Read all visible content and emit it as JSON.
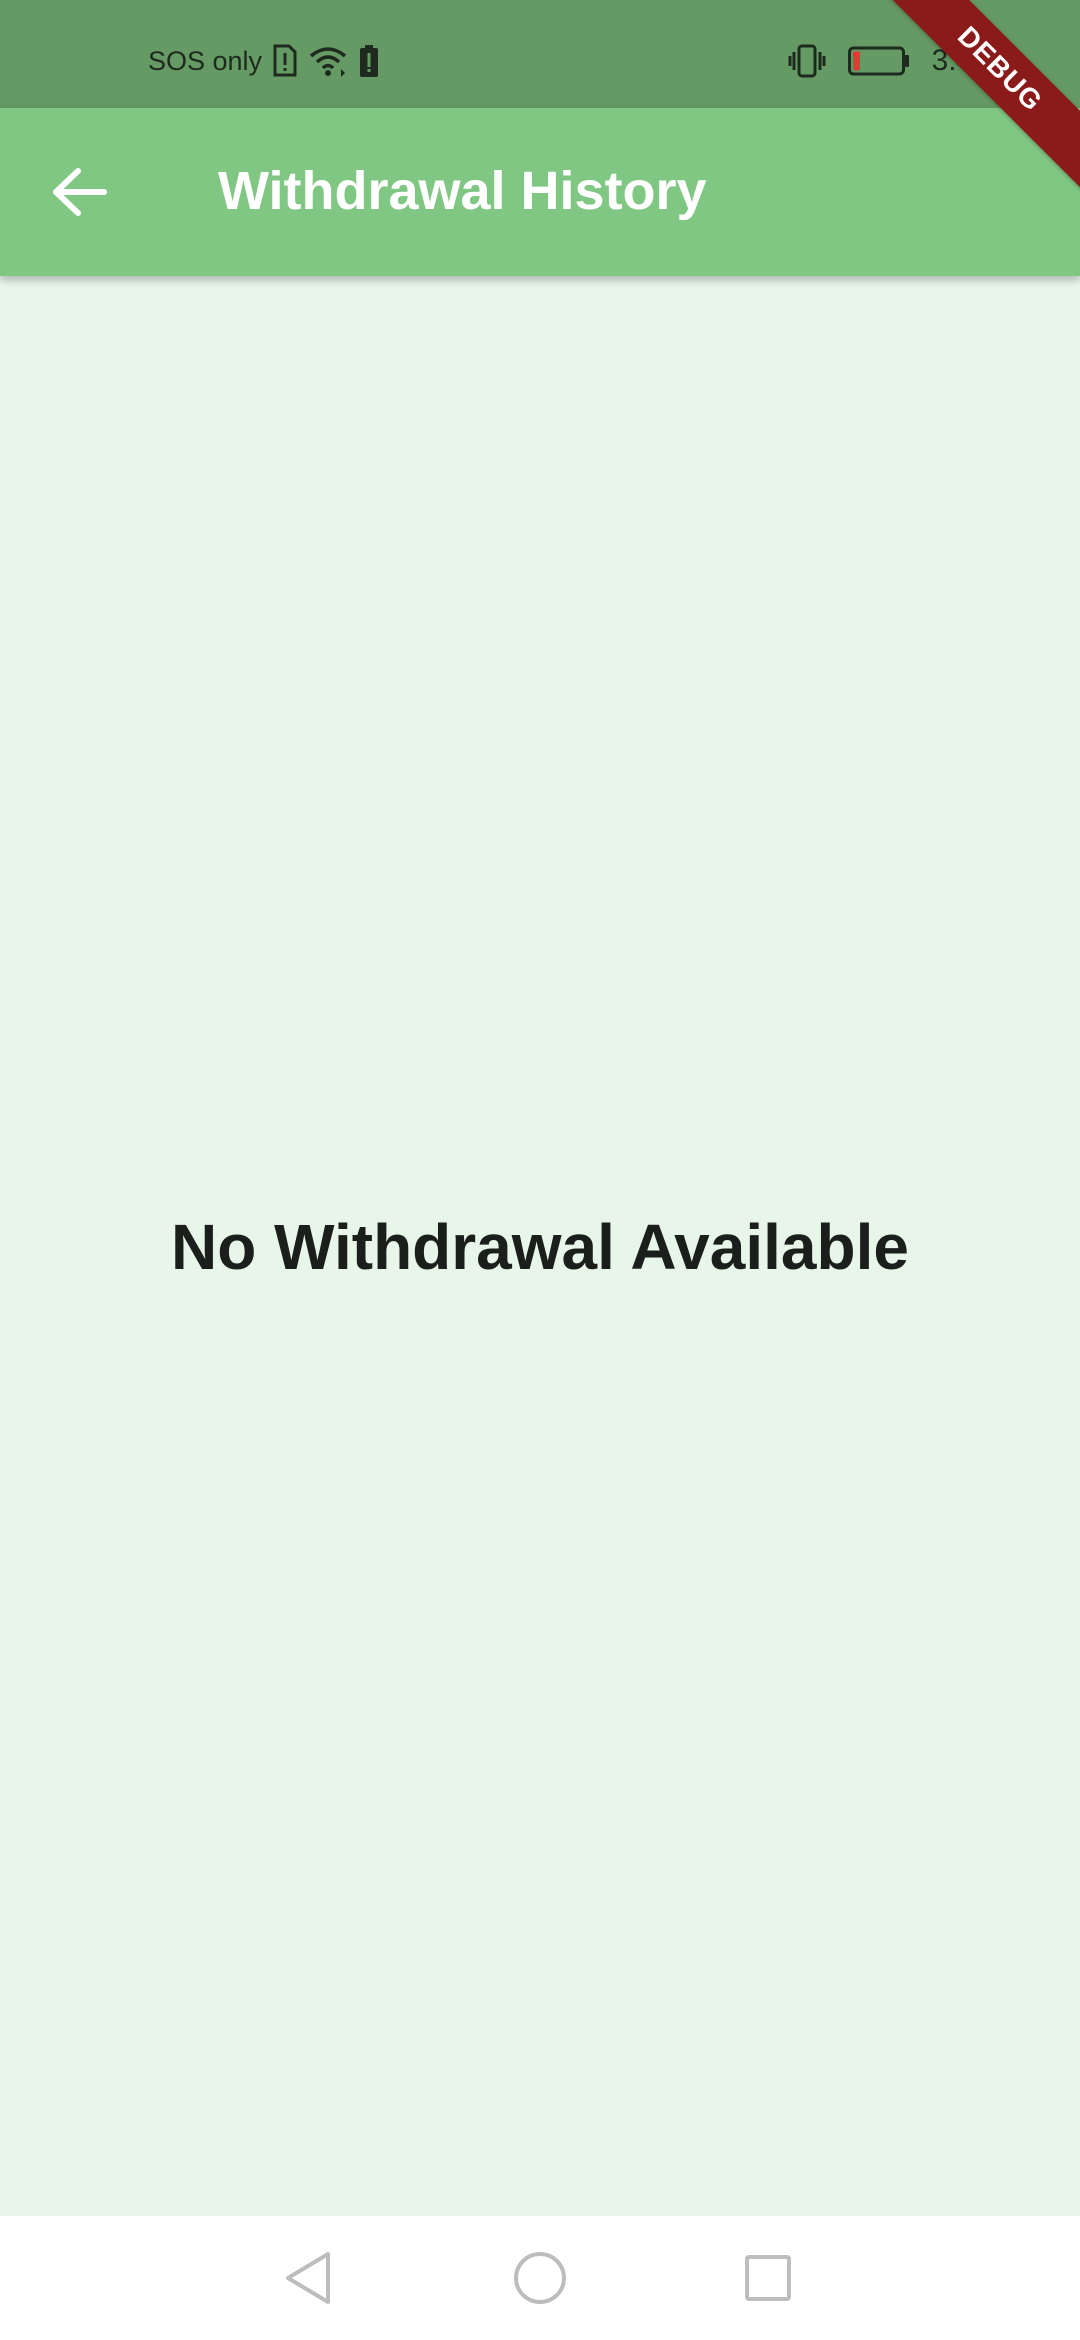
{
  "status_bar": {
    "carrier_text": "SOS only",
    "time": "3:47",
    "icons": [
      "sim-alert-icon",
      "wifi-icon",
      "battery-alert-icon",
      "vibrate-icon",
      "battery-low-icon"
    ]
  },
  "app_bar": {
    "title": "Withdrawal History",
    "back_icon": "arrow-back-icon"
  },
  "main": {
    "empty_message": "No Withdrawal Available"
  },
  "debug_banner": {
    "label": "DEBUG"
  },
  "nav_bar": {
    "icons": [
      "back-triangle-icon",
      "home-circle-icon",
      "recents-square-icon"
    ]
  },
  "colors": {
    "status_bar": "#659A64",
    "app_bar": "#81C784",
    "background": "#E8F5E9",
    "debug_banner": "#8B1A1A",
    "battery_low": "#E53935"
  }
}
